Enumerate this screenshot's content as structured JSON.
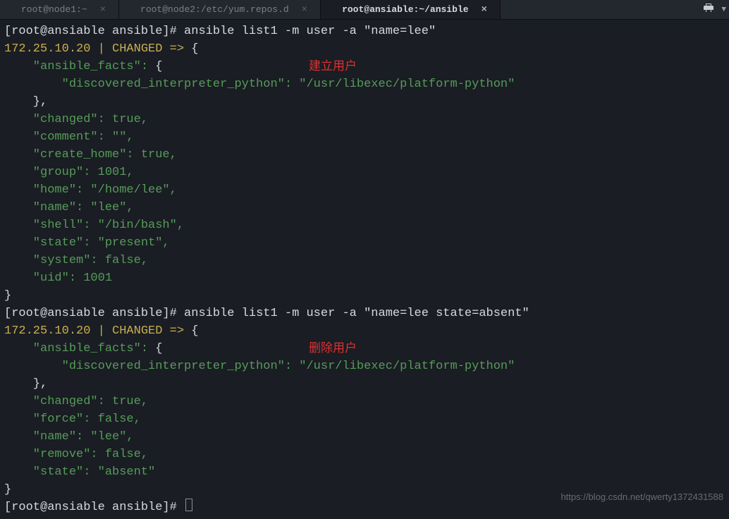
{
  "tabs": [
    {
      "label": "root@node1:~"
    },
    {
      "label": "root@node2:/etc/yum.repos.d"
    },
    {
      "label": "root@ansiable:~/ansible"
    }
  ],
  "prompt1": "[root@ansiable ansible]# ",
  "cmd1": "ansible list1 -m user -a \"name=lee\"",
  "status1": "172.25.10.20 | CHANGED => ",
  "brace_open": "{",
  "brace_close": "}",
  "ansible_facts_key": "    \"ansible_facts\": ",
  "disc_key": "        \"discovered_interpreter_python\": ",
  "disc_val": "\"/usr/libexec/platform-python\"",
  "close_brace_indent": "    },",
  "changed_line": "    \"changed\": true,",
  "comment_line": "    \"comment\": \"\",",
  "create_home_line": "    \"create_home\": true,",
  "group_line": "    \"group\": 1001,",
  "home_line": "    \"home\": \"/home/lee\",",
  "name_line": "    \"name\": \"lee\",",
  "shell_line": "    \"shell\": \"/bin/bash\",",
  "state1_line": "    \"state\": \"present\",",
  "system_line": "    \"system\": false,",
  "uid_line": "    \"uid\": 1001",
  "annotation1": "建立用户",
  "prompt2": "[root@ansiable ansible]# ",
  "cmd2": "ansible list1 -m user -a \"name=lee state=absent\"",
  "status2": "172.25.10.20 | CHANGED => ",
  "force_line": "    \"force\": false,",
  "remove_line": "    \"remove\": false,",
  "state2_line": "    \"state\": \"absent\"",
  "annotation2": "删除用户",
  "prompt3": "[root@ansiable ansible]# ",
  "watermark": "https://blog.csdn.net/qwerty1372431588"
}
